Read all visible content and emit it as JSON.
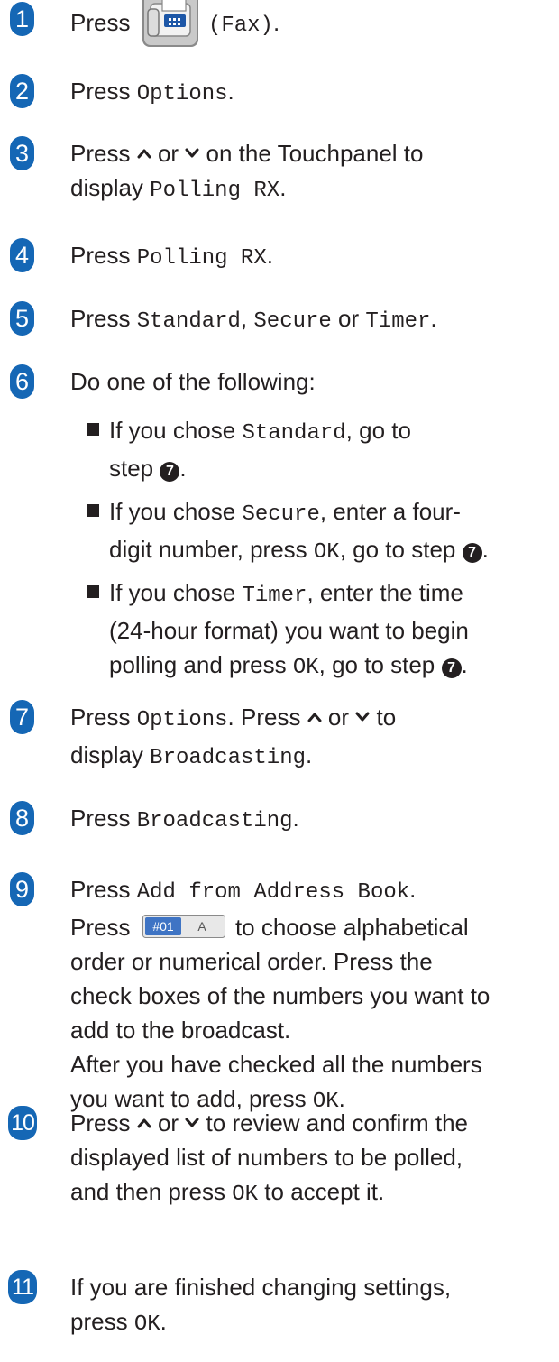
{
  "steps": [
    {
      "num": "1",
      "press": "Press",
      "fax": "(Fax)",
      "end": "."
    },
    {
      "num": "2",
      "press": "Press",
      "ui": "Options",
      "end": "."
    },
    {
      "num": "3",
      "press": "Press",
      "or": "or",
      "l1": "on the Touchpanel to",
      "display": "display",
      "ui": "Polling RX",
      "end": "."
    },
    {
      "num": "4",
      "press": "Press",
      "ui": "Polling RX",
      "end": "."
    },
    {
      "num": "5",
      "press": "Press",
      "ui1": "Standard",
      "comma": ",",
      "ui2": "Secure",
      "or": "or",
      "ui3": "Timer",
      "end": "."
    },
    {
      "num": "6",
      "text": "Do one of the following:",
      "bullets": [
        {
          "pre": "If you chose",
          "ui": "Standard",
          "mid": ", go to",
          "l2": "step",
          "ref": "7",
          "end": "."
        },
        {
          "pre": "If you chose",
          "ui": "Secure",
          "mid": ", enter a four-",
          "l2": "digit number, press",
          "ok": "OK",
          "mid2": ", go to step",
          "ref": "7",
          "end": "."
        },
        {
          "pre": "If you chose",
          "ui": "Timer",
          "mid": ", enter the time",
          "l2": "(24-hour format) you want to begin",
          "l3": "polling and press",
          "ok": "OK",
          "mid2": ", go to step",
          "ref": "7",
          "end": "."
        }
      ]
    },
    {
      "num": "7",
      "press": "Press",
      "ui": "Options",
      "mid": ". Press",
      "or": "or",
      "to": "to",
      "display": "display",
      "ui2": "Broadcasting",
      "end": "."
    },
    {
      "num": "8",
      "press": "Press",
      "ui": "Broadcasting",
      "end": "."
    },
    {
      "num": "9",
      "press": "Press",
      "ui": "Add from Address Book",
      "end": ".",
      "l2a": "Press",
      "l2b": "to choose alphabetical",
      "l3": "order or numerical order. Press the",
      "l4": "check boxes of the numbers you want to",
      "l5": "add to the broadcast.",
      "l6": "After you have checked all the numbers",
      "l7": "you want to add, press",
      "ok": "OK",
      "end2": "."
    },
    {
      "num": "10",
      "press": "Press",
      "or": "or",
      "l1": "to review and confirm the",
      "l2": "displayed list of numbers to be polled,",
      "l3a": "and then press",
      "ok": "OK",
      "l3b": "to accept it."
    },
    {
      "num": "11",
      "l1": "If you are finished changing settings,",
      "l2": "press",
      "ok": "OK",
      "end": "."
    }
  ],
  "sort_button": {
    "left": "#01",
    "right": "A"
  },
  "colors": {
    "badge": "#1567b5",
    "text": "#231f20"
  },
  "icons": [
    "fax-icon",
    "arrow-up-icon",
    "arrow-down-icon",
    "sort-order-button-icon",
    "step-ref-circle-icon"
  ]
}
